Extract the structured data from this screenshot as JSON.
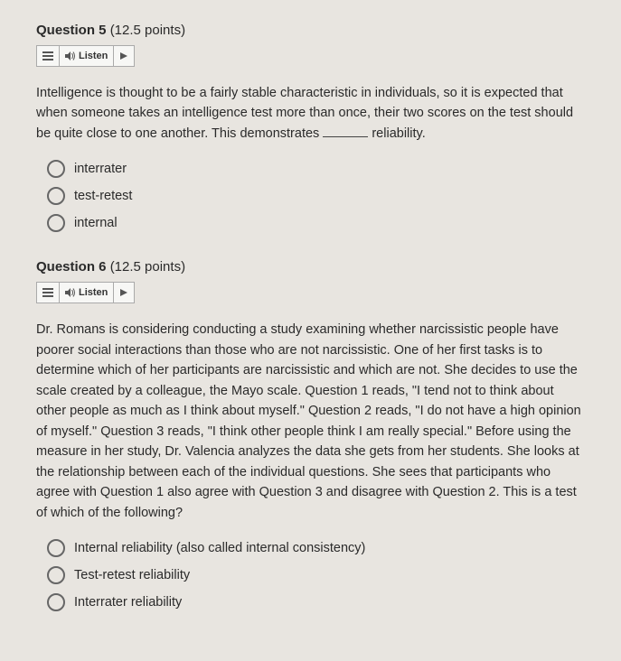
{
  "questions": [
    {
      "number": "Question 5",
      "points": "(12.5 points)",
      "listen_label": "Listen",
      "text_before": "Intelligence is thought to be a fairly stable characteristic in individuals, so it is expected that when someone takes an intelligence test more than once, their two scores on the test should be quite close to one another. This demonstrates ",
      "text_after": " reliability.",
      "options": [
        "interrater",
        "test-retest",
        "internal"
      ]
    },
    {
      "number": "Question 6",
      "points": "(12.5 points)",
      "listen_label": "Listen",
      "text_before": "Dr. Romans is considering conducting a study examining whether narcissistic people have poorer social interactions than those who are not narcissistic. One of her first tasks is to determine which of her participants are narcissistic and which are not. She decides to use the scale created by a colleague, the Mayo scale. Question 1 reads, \"I tend not to think about other people as much as I think about myself.\" Question 2 reads, \"I do not have a high opinion of myself.\" Question 3 reads, \"I think other people think I am really special.\" Before using the measure in her study, Dr. Valencia analyzes the data she gets from her students. She looks at the relationship between each of the individual questions. She sees that participants who agree with Question 1 also agree with Question 3 and disagree with Question 2. This is a test of which of the following?",
      "text_after": "",
      "options": [
        "Internal reliability (also called internal consistency)",
        "Test-retest reliability",
        "Interrater reliability"
      ]
    }
  ]
}
